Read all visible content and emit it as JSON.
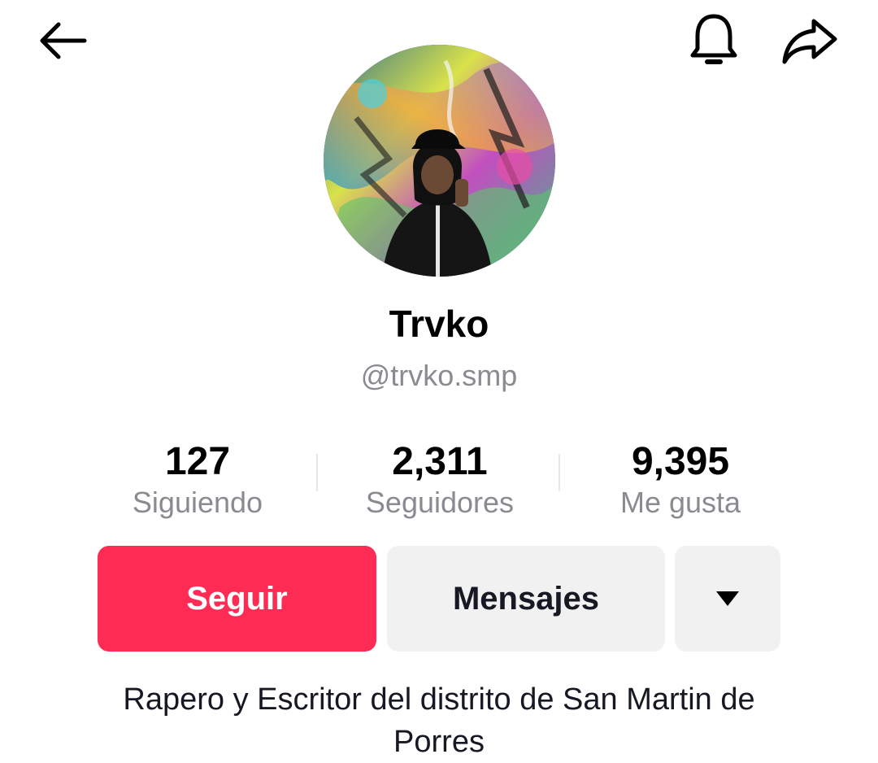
{
  "header": {
    "back_icon": "arrow-left-icon",
    "bell_icon": "bell-icon",
    "share_icon": "share-arrow-icon"
  },
  "profile": {
    "display_name": "Trvko",
    "username": "@trvko.smp",
    "bio": "Rapero y Escritor del distrito de San Martin de Porres"
  },
  "stats": [
    {
      "value": "127",
      "label": "Siguiendo"
    },
    {
      "value": "2,311",
      "label": "Seguidores"
    },
    {
      "value": "9,395",
      "label": "Me gusta"
    }
  ],
  "actions": {
    "follow_label": "Seguir",
    "message_label": "Mensajes",
    "more_icon": "caret-down-icon"
  },
  "colors": {
    "accent": "#fe2c55",
    "secondary_button": "#f1f1f2",
    "muted_text": "#8a8b91"
  }
}
